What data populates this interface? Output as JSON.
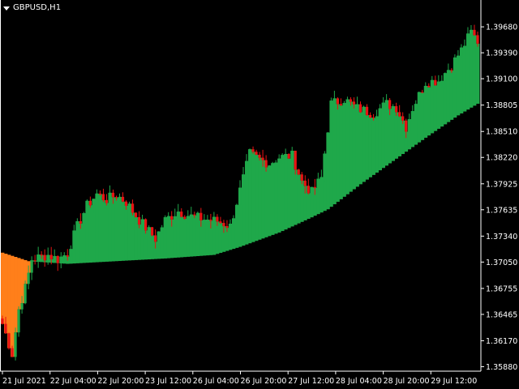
{
  "window": {
    "symbol_timeframe": "GBPUSD,H1",
    "menu_icon": "triangle-down-icon"
  },
  "colors": {
    "background": "#000000",
    "axis": "#ffffff",
    "bull": "#1fa84a",
    "bear": "#e81313",
    "fill_up": "#1fa84a",
    "fill_down": "#ff7f1a",
    "wick": "#ffffff"
  },
  "chart_data": {
    "type": "candlestick",
    "symbol": "GBPUSD",
    "timeframe": "H1",
    "price_axis": {
      "labels": [
        "1.39680",
        "1.39390",
        "1.39100",
        "1.38805",
        "1.38510",
        "1.38220",
        "1.37925",
        "1.37635",
        "1.37340",
        "1.37050",
        "1.36755",
        "1.36465",
        "1.36170",
        "1.35880"
      ],
      "values": [
        1.3968,
        1.3939,
        1.391,
        1.38805,
        1.3851,
        1.3822,
        1.37925,
        1.37635,
        1.3734,
        1.3705,
        1.36755,
        1.36465,
        1.3617,
        1.3588
      ],
      "range": [
        1.3583,
        1.3998
      ]
    },
    "time_axis": {
      "labels": [
        "21 Jul 2021",
        "22 Jul 04:00",
        "22 Jul 20:00",
        "23 Jul 12:00",
        "26 Jul 04:00",
        "26 Jul 20:00",
        "27 Jul 12:00",
        "28 Jul 04:00",
        "28 Jul 20:00",
        "29 Jul 12:00"
      ]
    },
    "bars_visible": 147,
    "close_anchors": [
      [
        0,
        1.3636
      ],
      [
        3,
        1.3602
      ],
      [
        5,
        1.3652
      ],
      [
        7,
        1.3676
      ],
      [
        9,
        1.3708
      ],
      [
        14,
        1.3713
      ],
      [
        17,
        1.3708
      ],
      [
        20,
        1.3715
      ],
      [
        23,
        1.3745
      ],
      [
        26,
        1.3768
      ],
      [
        29,
        1.3781
      ],
      [
        32,
        1.3775
      ],
      [
        35,
        1.378
      ],
      [
        38,
        1.3772
      ],
      [
        42,
        1.3752
      ],
      [
        47,
        1.3731
      ],
      [
        50,
        1.3752
      ],
      [
        54,
        1.3762
      ],
      [
        58,
        1.3756
      ],
      [
        62,
        1.3753
      ],
      [
        66,
        1.3751
      ],
      [
        70,
        1.3745
      ],
      [
        73,
        1.3785
      ],
      [
        76,
        1.3826
      ],
      [
        79,
        1.382
      ],
      [
        82,
        1.3815
      ],
      [
        85,
        1.3822
      ],
      [
        89,
        1.3824
      ],
      [
        92,
        1.3795
      ],
      [
        95,
        1.3783
      ],
      [
        98,
        1.3799
      ],
      [
        101,
        1.3882
      ],
      [
        105,
        1.3887
      ],
      [
        109,
        1.3877
      ],
      [
        114,
        1.3871
      ],
      [
        118,
        1.3882
      ],
      [
        121,
        1.3878
      ],
      [
        124,
        1.3856
      ],
      [
        126,
        1.3877
      ],
      [
        130,
        1.3906
      ],
      [
        134,
        1.3908
      ],
      [
        138,
        1.3925
      ],
      [
        141,
        1.3942
      ],
      [
        144,
        1.3962
      ],
      [
        146,
        1.3952
      ]
    ],
    "baseline_anchors": [
      [
        0,
        1.37155
      ],
      [
        8,
        1.3706
      ],
      [
        20,
        1.3703
      ],
      [
        35,
        1.3706
      ],
      [
        50,
        1.3709
      ],
      [
        65,
        1.3713
      ],
      [
        73,
        1.3722
      ],
      [
        85,
        1.3738
      ],
      [
        95,
        1.3755
      ],
      [
        100,
        1.3764
      ],
      [
        110,
        1.3792
      ],
      [
        120,
        1.3818
      ],
      [
        130,
        1.3844
      ],
      [
        140,
        1.3869
      ],
      [
        146,
        1.3882
      ]
    ]
  }
}
